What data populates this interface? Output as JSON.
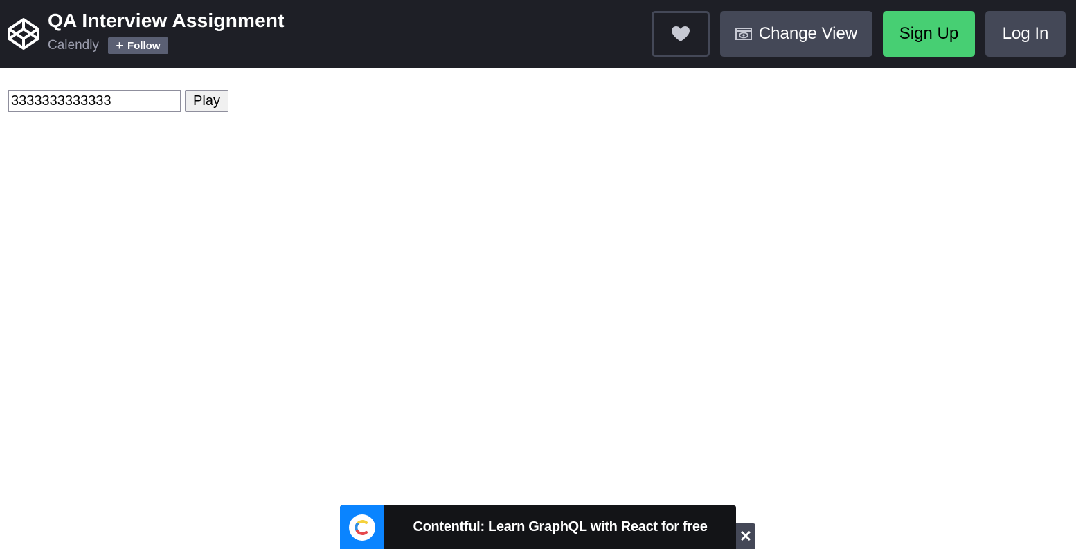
{
  "header": {
    "title": "QA Interview Assignment",
    "author": "Calendly",
    "follow_label": "Follow",
    "change_view_label": "Change View",
    "signup_label": "Sign Up",
    "login_label": "Log In",
    "logo_icon": "codepen-logo-icon",
    "heart_icon": "heart-icon",
    "eye_icon": "eye-icon",
    "colors": {
      "background": "#1e1f26",
      "button": "#444857",
      "signup": "#47cf73",
      "follow": "#5a5f73"
    }
  },
  "main": {
    "input_value": "3333333333333",
    "play_label": "Play"
  },
  "ad": {
    "text": "Contentful: Learn GraphQL with React for free",
    "logo_icon": "contentful-logo-icon",
    "close_icon": "close-icon",
    "colors": {
      "logo_bg": "#0a84ff",
      "background": "#131417"
    }
  }
}
